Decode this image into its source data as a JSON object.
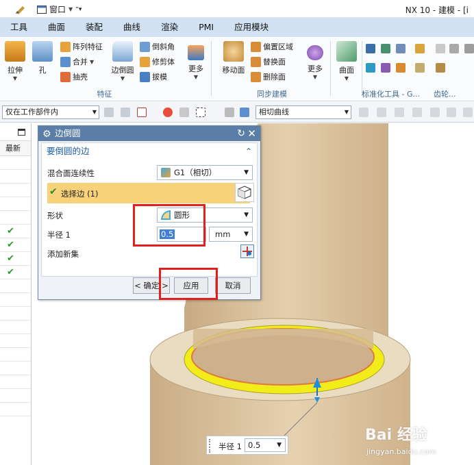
{
  "titlebar": {
    "window_menu": "窗口",
    "app_title": "NX 10 - 建模 - [i"
  },
  "menubar": {
    "items": [
      "工具",
      "曲面",
      "装配",
      "曲线",
      "渲染",
      "PMI",
      "应用模块"
    ]
  },
  "ribbon": {
    "feature": {
      "extrude": "拉伸",
      "hole": "孔",
      "pattern": "阵列特征",
      "unite": "合并",
      "shell": "抽壳",
      "edge_blend": "边倒圆",
      "chamfer": "倒斜角",
      "trim_body": "修剪体",
      "draft": "拔模",
      "more": "更多",
      "group_label": "特征"
    },
    "sync": {
      "move_face": "移动面",
      "offset_region": "偏置区域",
      "replace_face": "替换面",
      "delete_face": "删除面",
      "more": "更多",
      "group_label": "同步建模"
    },
    "surface": {
      "surface": "曲面"
    },
    "standard_tools": {
      "group_label": "标准化工具 - G..."
    },
    "gear": {
      "group_label": "齿轮..."
    }
  },
  "toolbar": {
    "filter_value": "仅在工作部件内",
    "curve_rule": "相切曲线"
  },
  "leftnav": {
    "column_header": "最新",
    "check_rows": 4
  },
  "dialog": {
    "title": "边倒圆",
    "section_title": "要倒圆的边",
    "blend_continuity_label": "混合面连续性",
    "blend_continuity_value": "G1（相切）",
    "select_edge_label": "选择边 (1)",
    "shape_label": "形状",
    "shape_value": "圆形",
    "radius_label": "半径 1",
    "radius_value": "0.5",
    "radius_unit": "mm",
    "add_new_set_label": "添加新集",
    "ok_button": "< 确定 >",
    "apply_button": "应用",
    "cancel_button": "取消"
  },
  "viewport_tag": {
    "label": "半径 1",
    "value": "0.5"
  },
  "watermark": {
    "brand": "Bai 经验",
    "url": "jingyan.baidu.com"
  },
  "colors": {
    "menubar_bg": "#d2e2f3",
    "dialog_title_bg": "#5a7ea5",
    "section_title": "#1f5fa8",
    "selected_row": "#f8d27b",
    "highlight_box": "#e01f1f",
    "model_tan": "#d9c19d",
    "edge_yellow": "#f1ec1a"
  }
}
